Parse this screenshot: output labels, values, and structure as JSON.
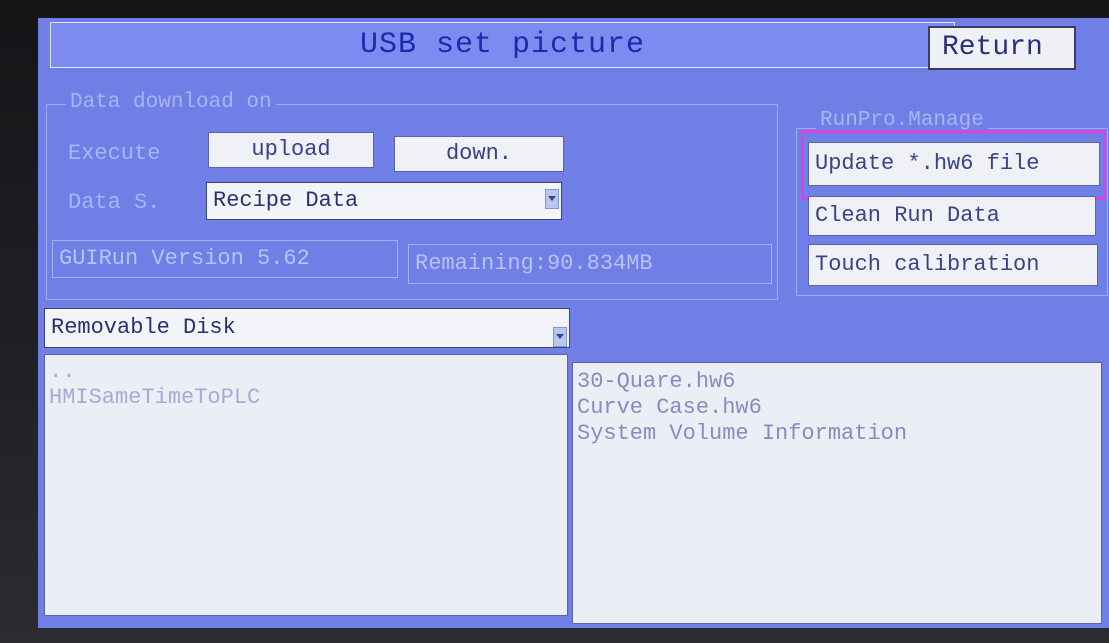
{
  "header": {
    "title": "USB set picture",
    "return_label": "Return"
  },
  "download_group": {
    "legend": "Data download on",
    "execute_label": "Execute",
    "upload_label": "upload",
    "down_label": "down.",
    "data_label": "Data S.",
    "data_select_value": "Recipe Data",
    "version_text": "GUIRun Version 5.62",
    "remaining_text": "Remaining:90.834MB"
  },
  "runpro_group": {
    "legend": "RunPro.Manage",
    "update_label": "Update *.hw6 file",
    "clean_label": "Clean Run Data",
    "touch_label": "Touch calibration"
  },
  "disk_select": {
    "value": "Removable Disk"
  },
  "left_list": {
    "items": [
      "..",
      "HMISameTimeToPLC"
    ]
  },
  "right_list": {
    "items": [
      "30-Quare.hw6",
      "Curve Case.hw6",
      "System Volume Information"
    ]
  },
  "colors": {
    "screen_bg": "#6f7fe6",
    "highlight": "#e23fe0",
    "title_text": "#1a2bb0"
  }
}
